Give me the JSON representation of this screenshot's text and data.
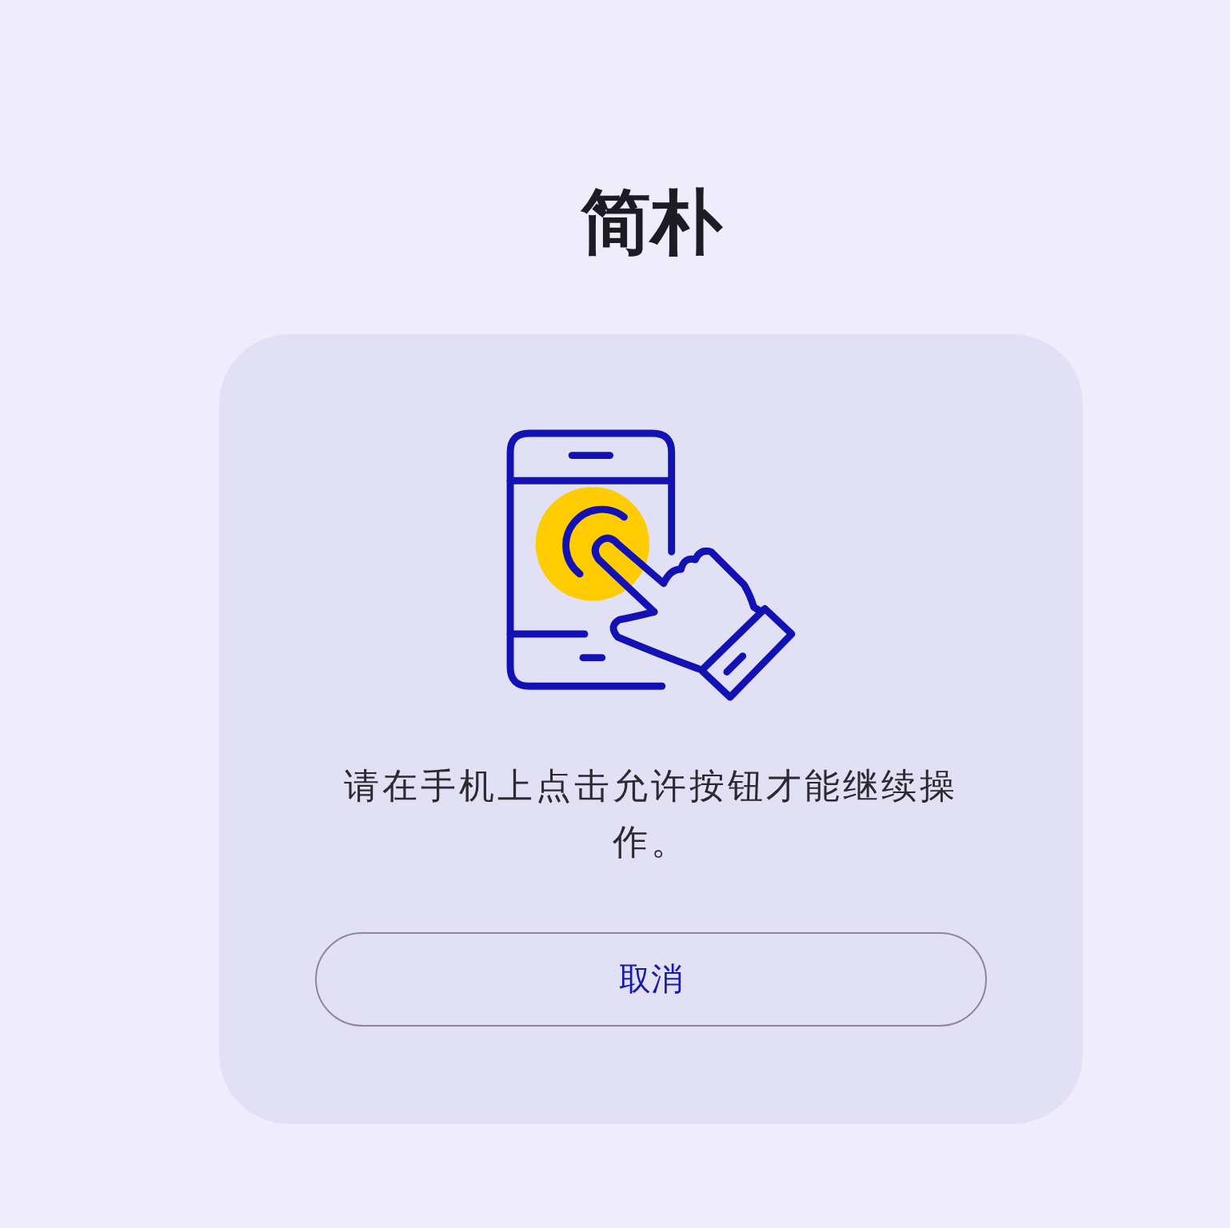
{
  "title": "简朴",
  "card": {
    "message": "请在手机上点击允许按钮才能继续操作。",
    "button": {
      "label": "取消"
    }
  }
}
